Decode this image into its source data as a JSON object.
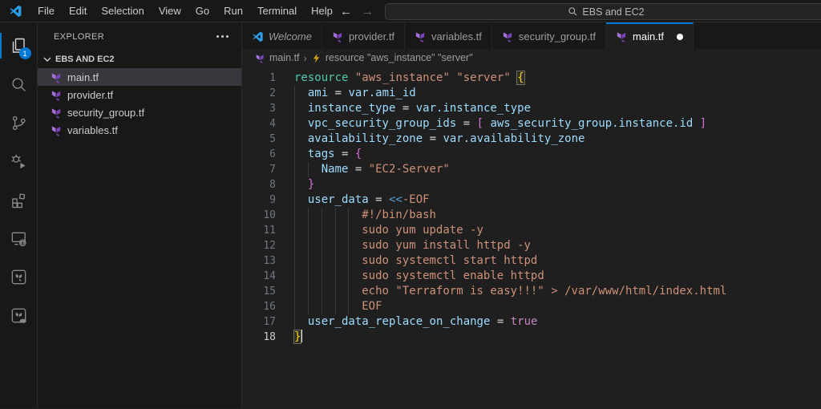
{
  "titlebar": {
    "menus": [
      "File",
      "Edit",
      "Selection",
      "View",
      "Go",
      "Run",
      "Terminal",
      "Help"
    ],
    "search_text": "EBS and EC2",
    "icons": [
      "vscode-logo",
      "arrow-back",
      "arrow-forward",
      "search-icon"
    ]
  },
  "activitybar": {
    "items": [
      {
        "name": "explorer",
        "icon": "files-icon",
        "active": true,
        "badge": "1"
      },
      {
        "name": "search",
        "icon": "search-icon",
        "active": false
      },
      {
        "name": "source-control",
        "icon": "source-control-icon",
        "active": false
      },
      {
        "name": "run-debug",
        "icon": "debug-icon",
        "active": false
      },
      {
        "name": "extensions",
        "icon": "extensions-icon",
        "active": false
      },
      {
        "name": "remote-explorer",
        "icon": "remote-explorer-icon",
        "active": false
      },
      {
        "name": "terraform",
        "icon": "terraform-box-icon",
        "active": false
      },
      {
        "name": "terraform-cloud",
        "icon": "terraform-cloud-icon",
        "active": false
      }
    ]
  },
  "sidebar": {
    "title": "EXPLORER",
    "section": "EBS AND EC2",
    "files": [
      {
        "name": "main.tf",
        "selected": true
      },
      {
        "name": "provider.tf",
        "selected": false
      },
      {
        "name": "security_group.tf",
        "selected": false
      },
      {
        "name": "variables.tf",
        "selected": false
      }
    ]
  },
  "tabs": [
    {
      "label": "Welcome",
      "icon": "vscode",
      "active": false,
      "dirty": false,
      "italic": true
    },
    {
      "label": "provider.tf",
      "icon": "terraform",
      "active": false,
      "dirty": false,
      "italic": false
    },
    {
      "label": "variables.tf",
      "icon": "terraform",
      "active": false,
      "dirty": false,
      "italic": false
    },
    {
      "label": "security_group.tf",
      "icon": "terraform",
      "active": false,
      "dirty": false,
      "italic": false
    },
    {
      "label": "main.tf",
      "icon": "terraform",
      "active": true,
      "dirty": true,
      "italic": false
    }
  ],
  "breadcrumb": {
    "file": "main.tf",
    "separator": "›",
    "symbol": "resource \"aws_instance\" \"server\""
  },
  "colors": {
    "accent_blue": "#0078d4",
    "terraform_purple": "#7B42BC",
    "terraform_light_purple": "#A371D6",
    "keyword": "#4EC9B0",
    "string": "#CE9178",
    "variable": "#9CDCFE",
    "bracket_gold": "#FFD602",
    "bracket_pink": "#D670D6",
    "boolean": "#C586C0"
  },
  "editor": {
    "active_line": 18,
    "lines": [
      {
        "n": 1,
        "g": 0,
        "s": [
          [
            "kw",
            "resource"
          ],
          [
            "pl",
            " "
          ],
          [
            "str",
            "\"aws_instance\""
          ],
          [
            "pl",
            " "
          ],
          [
            "str",
            "\"server\""
          ],
          [
            "pl",
            " "
          ],
          [
            "b1x",
            "{"
          ]
        ]
      },
      {
        "n": 2,
        "g": 1,
        "s": [
          [
            "var",
            "ami"
          ],
          [
            "pl",
            " = "
          ],
          [
            "var",
            "var.ami_id"
          ]
        ]
      },
      {
        "n": 3,
        "g": 1,
        "s": [
          [
            "var",
            "instance_type"
          ],
          [
            "pl",
            " = "
          ],
          [
            "var",
            "var.instance_type"
          ]
        ]
      },
      {
        "n": 4,
        "g": 1,
        "s": [
          [
            "var",
            "vpc_security_group_ids"
          ],
          [
            "pl",
            " = "
          ],
          [
            "b2",
            "["
          ],
          [
            "pl",
            " "
          ],
          [
            "var",
            "aws_security_group.instance.id"
          ],
          [
            "pl",
            " "
          ],
          [
            "b2",
            "]"
          ]
        ]
      },
      {
        "n": 5,
        "g": 1,
        "s": [
          [
            "var",
            "availability_zone"
          ],
          [
            "pl",
            " = "
          ],
          [
            "var",
            "var.availability_zone"
          ]
        ]
      },
      {
        "n": 6,
        "g": 1,
        "s": [
          [
            "var",
            "tags"
          ],
          [
            "pl",
            " = "
          ],
          [
            "b2",
            "{"
          ]
        ]
      },
      {
        "n": 7,
        "g": 2,
        "s": [
          [
            "var",
            "Name"
          ],
          [
            "pl",
            " = "
          ],
          [
            "str",
            "\"EC2-Server\""
          ]
        ]
      },
      {
        "n": 8,
        "g": 1,
        "s": [
          [
            "b2",
            "}"
          ]
        ]
      },
      {
        "n": 9,
        "g": 1,
        "s": [
          [
            "var",
            "user_data"
          ],
          [
            "pl",
            " = "
          ],
          [
            "op2",
            "<<"
          ],
          [
            "str",
            "-EOF"
          ]
        ]
      },
      {
        "n": 10,
        "g": 5,
        "s": [
          [
            "hd",
            "#!/bin/bash"
          ]
        ]
      },
      {
        "n": 11,
        "g": 5,
        "s": [
          [
            "hd",
            "sudo yum update -y"
          ]
        ]
      },
      {
        "n": 12,
        "g": 5,
        "s": [
          [
            "hd",
            "sudo yum install httpd -y"
          ]
        ]
      },
      {
        "n": 13,
        "g": 5,
        "s": [
          [
            "hd",
            "sudo systemctl start httpd"
          ]
        ]
      },
      {
        "n": 14,
        "g": 5,
        "s": [
          [
            "hd",
            "sudo systemctl enable httpd"
          ]
        ]
      },
      {
        "n": 15,
        "g": 5,
        "s": [
          [
            "hd",
            "echo \"Terraform is easy!!!\" > /var/www/html/index.html"
          ]
        ]
      },
      {
        "n": 16,
        "g": 5,
        "s": [
          [
            "hd",
            "EOF"
          ]
        ]
      },
      {
        "n": 17,
        "g": 1,
        "s": [
          [
            "var",
            "user_data_replace_on_change"
          ],
          [
            "pl",
            " = "
          ],
          [
            "bool",
            "true"
          ]
        ]
      },
      {
        "n": 18,
        "g": 0,
        "s": [
          [
            "b1x",
            "}"
          ]
        ],
        "caret": true
      }
    ]
  }
}
